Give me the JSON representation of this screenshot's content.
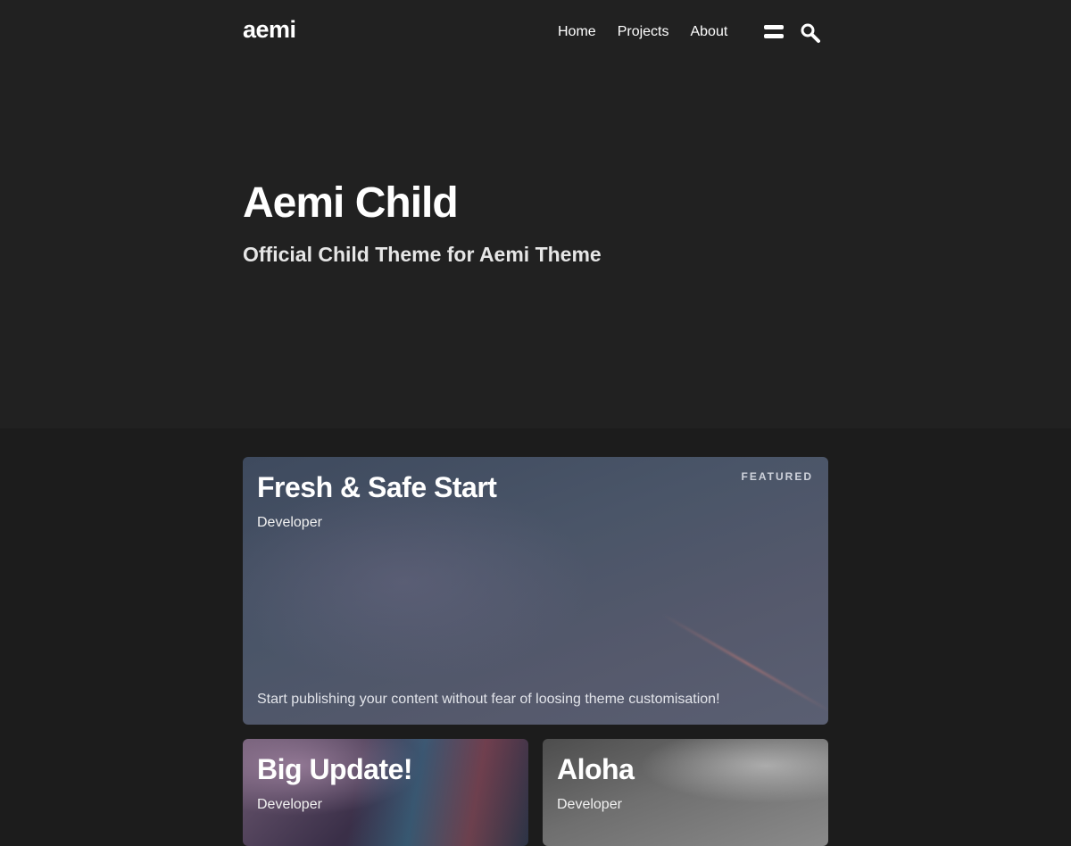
{
  "site": {
    "logo": "aemi"
  },
  "nav": {
    "items": [
      {
        "label": "Home"
      },
      {
        "label": "Projects"
      },
      {
        "label": "About"
      }
    ]
  },
  "header_icons": {
    "menu": "menu-icon",
    "search": "search-icon"
  },
  "hero": {
    "title": "Aemi Child",
    "subtitle": "Official Child Theme for Aemi Theme"
  },
  "posts": [
    {
      "title": "Fresh & Safe Start",
      "meta": "Developer",
      "badge": "FEATURED",
      "excerpt": "Start publishing your content without fear of loosing theme customisation!"
    },
    {
      "title": "Big Update!",
      "meta": "Developer"
    },
    {
      "title": "Aloha",
      "meta": "Developer"
    }
  ],
  "colors": {
    "header_bg": "#212121",
    "page_bg": "#1c1c1c",
    "text": "#ffffff"
  }
}
